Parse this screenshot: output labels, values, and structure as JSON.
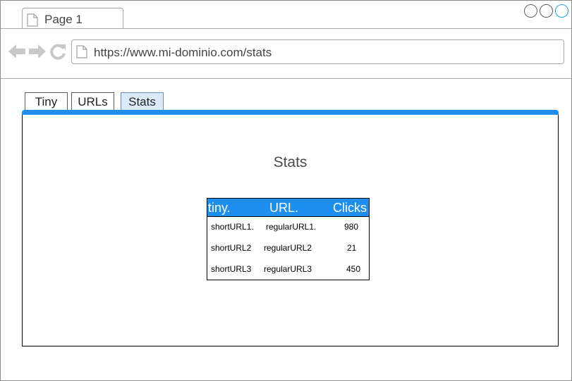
{
  "browser": {
    "tab_title": "Page 1",
    "url": "https://www.mi-dominio.com/stats"
  },
  "app_tabs": [
    {
      "label": "Tiny",
      "active": false
    },
    {
      "label": "URLs",
      "active": false
    },
    {
      "label": "Stats",
      "active": true
    }
  ],
  "colors": {
    "accent": "#1e8fef",
    "active_tab": "#dbeafb"
  },
  "page": {
    "title": "Stats"
  },
  "table": {
    "headers": [
      "tiny.",
      "URL.",
      "Clicks"
    ],
    "rows": [
      [
        "shortURL1.",
        "regularURL1.",
        "980"
      ],
      [
        "shortURL2",
        "regularURL2",
        "21"
      ],
      [
        "shortURL3",
        "regularURL3",
        "450"
      ]
    ]
  }
}
